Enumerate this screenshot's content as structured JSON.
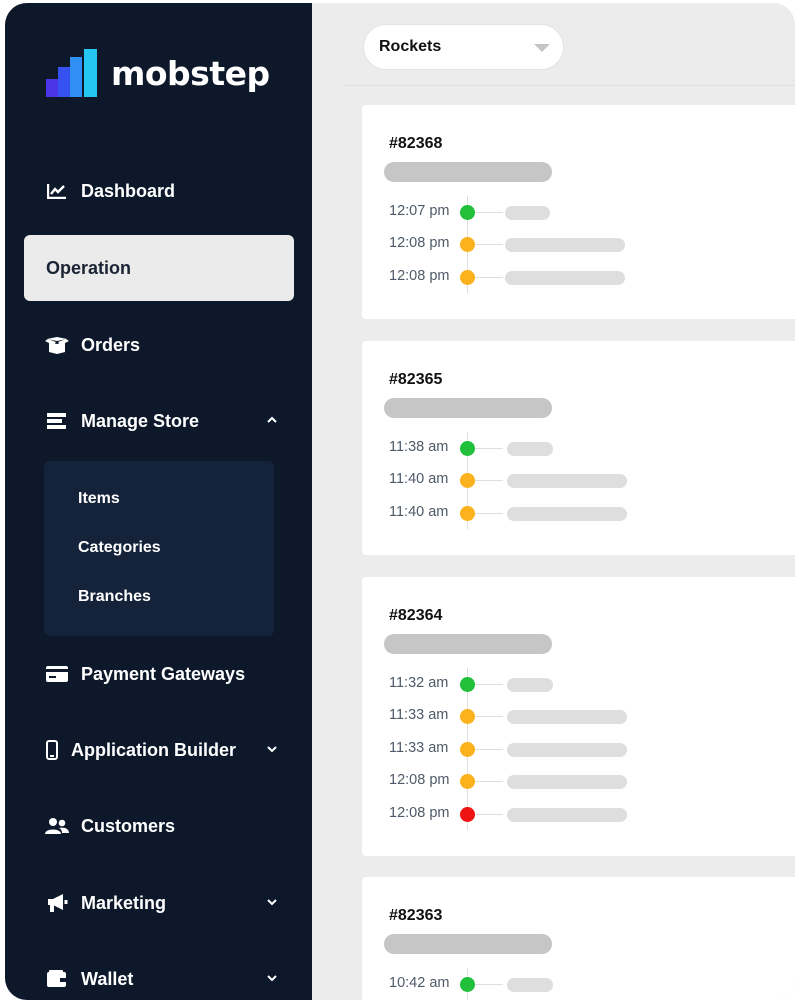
{
  "brand": {
    "name": "mobstep",
    "mark_icon": "bar-chart-logo"
  },
  "sidebar": {
    "items": [
      {
        "label": "Dashboard",
        "icon": "chart-line-icon"
      },
      {
        "label": "Operation",
        "active": true
      },
      {
        "label": "Orders",
        "icon": "box-open-icon"
      },
      {
        "label": "Manage Store",
        "icon": "store-list-icon",
        "expanded": true
      },
      {
        "label": "Payment Gateways",
        "icon": "credit-card-icon"
      },
      {
        "label": "Application Builder",
        "icon": "mobile-phone-icon"
      },
      {
        "label": "Customers",
        "icon": "users-icon"
      },
      {
        "label": "Marketing",
        "icon": "megaphone-icon"
      },
      {
        "label": "Wallet",
        "icon": "wallet-icon"
      }
    ],
    "submenu": [
      "Items",
      "Categories",
      "Branches"
    ]
  },
  "main": {
    "filter": {
      "value": "Rockets"
    },
    "status_colors": {
      "green": "#22c03a",
      "orange": "#fbb21c",
      "red": "#f01414"
    },
    "cards": [
      {
        "id": "#82368",
        "events": [
          {
            "time": "12:07 pm",
            "status": "green"
          },
          {
            "time": "12:08 pm",
            "status": "orange"
          },
          {
            "time": "12:08 pm",
            "status": "orange"
          }
        ]
      },
      {
        "id": "#82365",
        "events": [
          {
            "time": "11:38 am",
            "status": "green"
          },
          {
            "time": "11:40 am",
            "status": "orange"
          },
          {
            "time": "11:40 am",
            "status": "orange"
          }
        ]
      },
      {
        "id": "#82364",
        "events": [
          {
            "time": "11:32 am",
            "status": "green"
          },
          {
            "time": "11:33 am",
            "status": "orange"
          },
          {
            "time": "11:33 am",
            "status": "orange"
          },
          {
            "time": "12:08 pm",
            "status": "orange"
          },
          {
            "time": "12:08 pm",
            "status": "red"
          }
        ]
      },
      {
        "id": "#82363",
        "events": [
          {
            "time": "10:42 am",
            "status": "green"
          }
        ]
      }
    ]
  }
}
